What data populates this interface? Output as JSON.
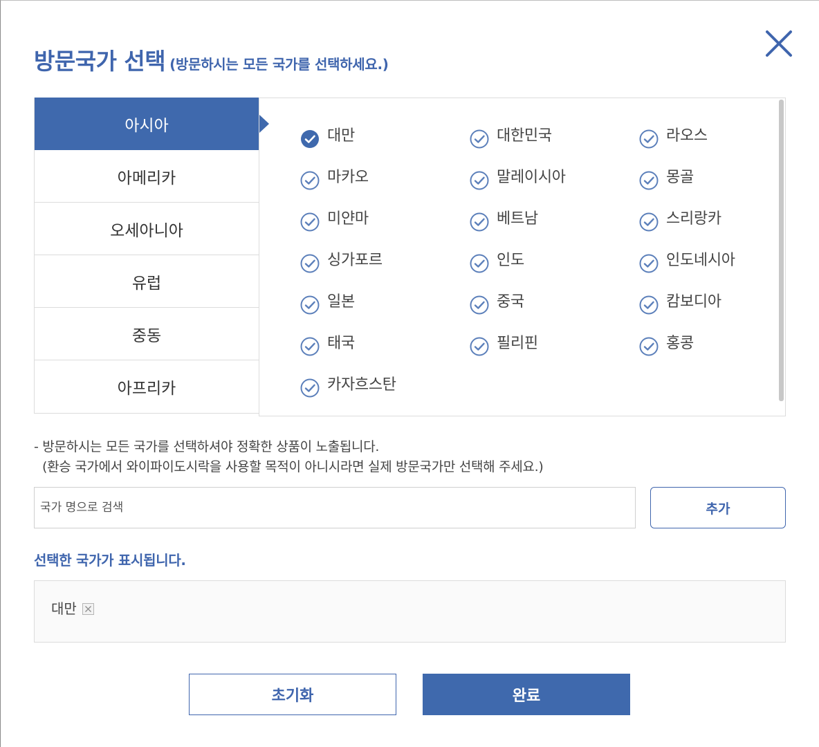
{
  "dialog": {
    "title": "방문국가 선택",
    "subtitle": "(방문하시는 모든 국가를 선택하세요.)",
    "close_icon": "close-icon"
  },
  "regions": [
    {
      "label": "아시아",
      "active": true
    },
    {
      "label": "아메리카",
      "active": false
    },
    {
      "label": "오세아니아",
      "active": false
    },
    {
      "label": "유럽",
      "active": false
    },
    {
      "label": "중동",
      "active": false
    },
    {
      "label": "아프리카",
      "active": false
    }
  ],
  "countries": [
    {
      "name": "대만",
      "checked": true
    },
    {
      "name": "대한민국",
      "checked": false
    },
    {
      "name": "라오스",
      "checked": false
    },
    {
      "name": "마카오",
      "checked": false
    },
    {
      "name": "말레이시아",
      "checked": false
    },
    {
      "name": "몽골",
      "checked": false
    },
    {
      "name": "미얀마",
      "checked": false
    },
    {
      "name": "베트남",
      "checked": false
    },
    {
      "name": "스리랑카",
      "checked": false
    },
    {
      "name": "싱가포르",
      "checked": false
    },
    {
      "name": "인도",
      "checked": false
    },
    {
      "name": "인도네시아",
      "checked": false
    },
    {
      "name": "일본",
      "checked": false
    },
    {
      "name": "중국",
      "checked": false
    },
    {
      "name": "캄보디아",
      "checked": false
    },
    {
      "name": "태국",
      "checked": false
    },
    {
      "name": "필리핀",
      "checked": false
    },
    {
      "name": "홍콩",
      "checked": false
    },
    {
      "name": "카자흐스탄",
      "checked": false
    }
  ],
  "notice": {
    "line1": "- 방문하시는 모든 국가를 선택하셔야 정확한 상품이 노출됩니다.",
    "line2": "(환승 국가에서 와이파이도시락을 사용할 목적이 아니시라면 실제 방문국가만 선택해 주세요.)"
  },
  "search": {
    "placeholder": "국가 명으로 검색",
    "value": "",
    "add_label": "추가"
  },
  "selected": {
    "label": "선택한 국가가 표시됩니다.",
    "items": [
      "대만"
    ]
  },
  "buttons": {
    "reset_label": "초기화",
    "done_label": "완료"
  },
  "colors": {
    "accent": "#3f69ad",
    "title": "#3f65ad",
    "check_unchecked": "#5b7fba",
    "check_checked": "#3f69ad"
  }
}
